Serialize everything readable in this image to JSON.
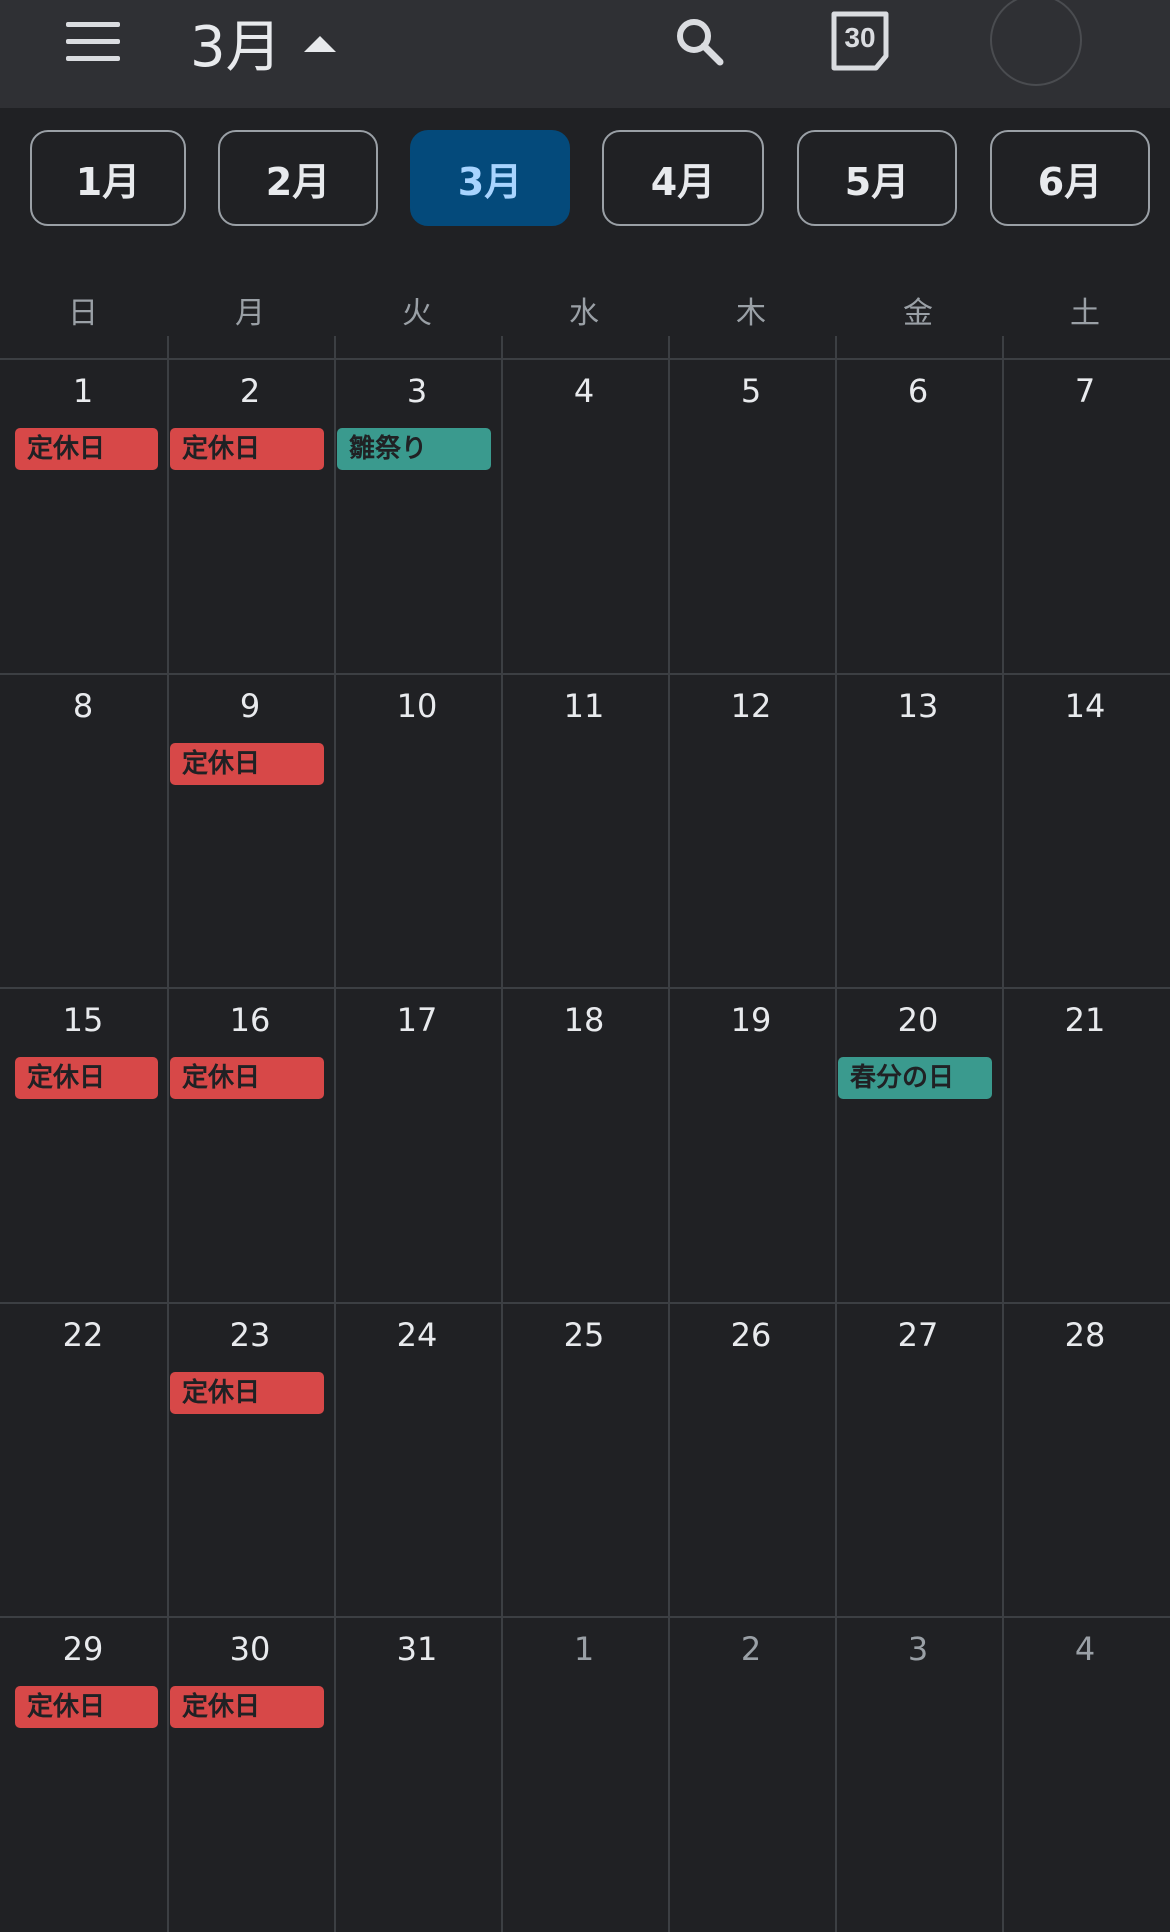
{
  "header": {
    "title": "3月",
    "today_icon_number": "30"
  },
  "month_chips": [
    {
      "label": "1月",
      "selected": false
    },
    {
      "label": "2月",
      "selected": false
    },
    {
      "label": "3月",
      "selected": true
    },
    {
      "label": "4月",
      "selected": false
    },
    {
      "label": "5月",
      "selected": false
    },
    {
      "label": "6月",
      "selected": false
    }
  ],
  "weekdays": [
    "日",
    "月",
    "火",
    "水",
    "木",
    "金",
    "土"
  ],
  "weeks": [
    [
      {
        "day": "1",
        "current_month": true,
        "events": [
          {
            "label": "定休日",
            "color": "#d74848"
          }
        ]
      },
      {
        "day": "2",
        "current_month": true,
        "events": [
          {
            "label": "定休日",
            "color": "#d74848"
          }
        ]
      },
      {
        "day": "3",
        "current_month": true,
        "events": [
          {
            "label": "雛祭り",
            "color": "#3a9a8e"
          }
        ]
      },
      {
        "day": "4",
        "current_month": true,
        "events": []
      },
      {
        "day": "5",
        "current_month": true,
        "events": []
      },
      {
        "day": "6",
        "current_month": true,
        "events": []
      },
      {
        "day": "7",
        "current_month": true,
        "events": []
      }
    ],
    [
      {
        "day": "8",
        "current_month": true,
        "events": []
      },
      {
        "day": "9",
        "current_month": true,
        "events": [
          {
            "label": "定休日",
            "color": "#d74848"
          }
        ]
      },
      {
        "day": "10",
        "current_month": true,
        "events": []
      },
      {
        "day": "11",
        "current_month": true,
        "events": []
      },
      {
        "day": "12",
        "current_month": true,
        "events": []
      },
      {
        "day": "13",
        "current_month": true,
        "events": []
      },
      {
        "day": "14",
        "current_month": true,
        "events": []
      }
    ],
    [
      {
        "day": "15",
        "current_month": true,
        "events": [
          {
            "label": "定休日",
            "color": "#d74848"
          }
        ]
      },
      {
        "day": "16",
        "current_month": true,
        "events": [
          {
            "label": "定休日",
            "color": "#d74848"
          }
        ]
      },
      {
        "day": "17",
        "current_month": true,
        "events": []
      },
      {
        "day": "18",
        "current_month": true,
        "events": []
      },
      {
        "day": "19",
        "current_month": true,
        "events": []
      },
      {
        "day": "20",
        "current_month": true,
        "events": [
          {
            "label": "春分の日",
            "color": "#3a9a8e"
          }
        ]
      },
      {
        "day": "21",
        "current_month": true,
        "events": []
      }
    ],
    [
      {
        "day": "22",
        "current_month": true,
        "events": []
      },
      {
        "day": "23",
        "current_month": true,
        "events": [
          {
            "label": "定休日",
            "color": "#d74848"
          }
        ]
      },
      {
        "day": "24",
        "current_month": true,
        "events": []
      },
      {
        "day": "25",
        "current_month": true,
        "events": []
      },
      {
        "day": "26",
        "current_month": true,
        "events": []
      },
      {
        "day": "27",
        "current_month": true,
        "events": []
      },
      {
        "day": "28",
        "current_month": true,
        "events": []
      }
    ],
    [
      {
        "day": "29",
        "current_month": true,
        "events": [
          {
            "label": "定休日",
            "color": "#d74848"
          }
        ]
      },
      {
        "day": "30",
        "current_month": true,
        "events": [
          {
            "label": "定休日",
            "color": "#d74848"
          }
        ]
      },
      {
        "day": "31",
        "current_month": true,
        "events": []
      },
      {
        "day": "1",
        "current_month": false,
        "events": []
      },
      {
        "day": "2",
        "current_month": false,
        "events": []
      },
      {
        "day": "3",
        "current_month": false,
        "events": []
      },
      {
        "day": "4",
        "current_month": false,
        "events": []
      }
    ]
  ],
  "colors": {
    "background": "#202124",
    "topbar": "#2f3034",
    "selected_chip": "#044a7b",
    "holiday_closed": "#d74848",
    "holiday_national": "#3a9a8e"
  }
}
